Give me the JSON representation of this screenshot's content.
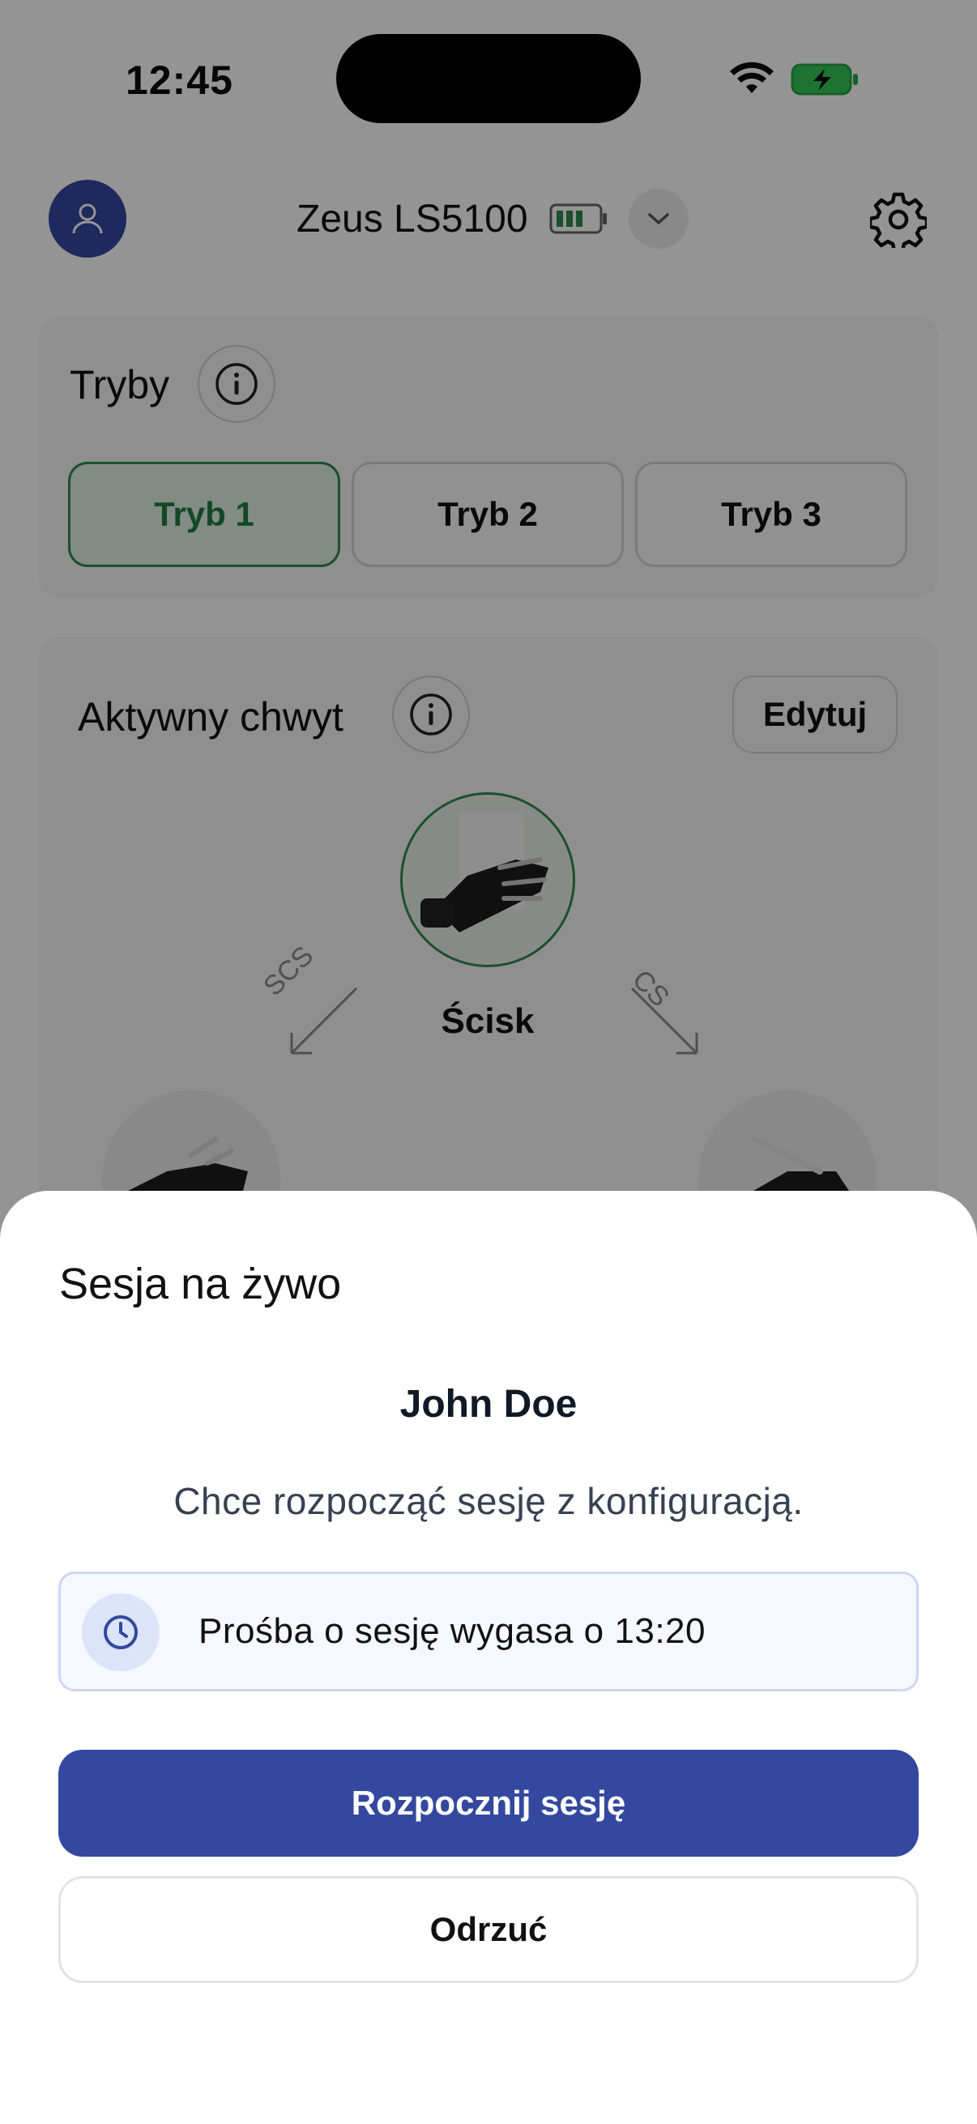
{
  "status_bar": {
    "time": "12:45"
  },
  "header": {
    "device_name": "Zeus LS5100",
    "avatar_icon": "user-icon",
    "settings_icon": "gear-icon",
    "selector_icon": "chevron-down-icon"
  },
  "modes": {
    "title": "Tryby",
    "buttons": [
      {
        "label": "Tryb 1",
        "active": true
      },
      {
        "label": "Tryb 2",
        "active": false
      },
      {
        "label": "Tryb 3",
        "active": false
      }
    ]
  },
  "active_grip": {
    "title": "Aktywny chwyt",
    "edit_label": "Edytuj",
    "current_grip": "Ścisk",
    "transition_left": "SCS",
    "transition_right": "CS"
  },
  "session_sheet": {
    "title": "Sesja na żywo",
    "requester_name": "John Doe",
    "message": "Chce rozpocząć sesję z konfiguracją.",
    "expiry_text": "Prośba o sesję wygasa o 13:20",
    "start_label": "Rozpocznij sesję",
    "reject_label": "Odrzuć"
  },
  "colors": {
    "accent": "#3448a0",
    "active_mode_green": "#2f8a4c",
    "battery_green": "#34c759"
  }
}
